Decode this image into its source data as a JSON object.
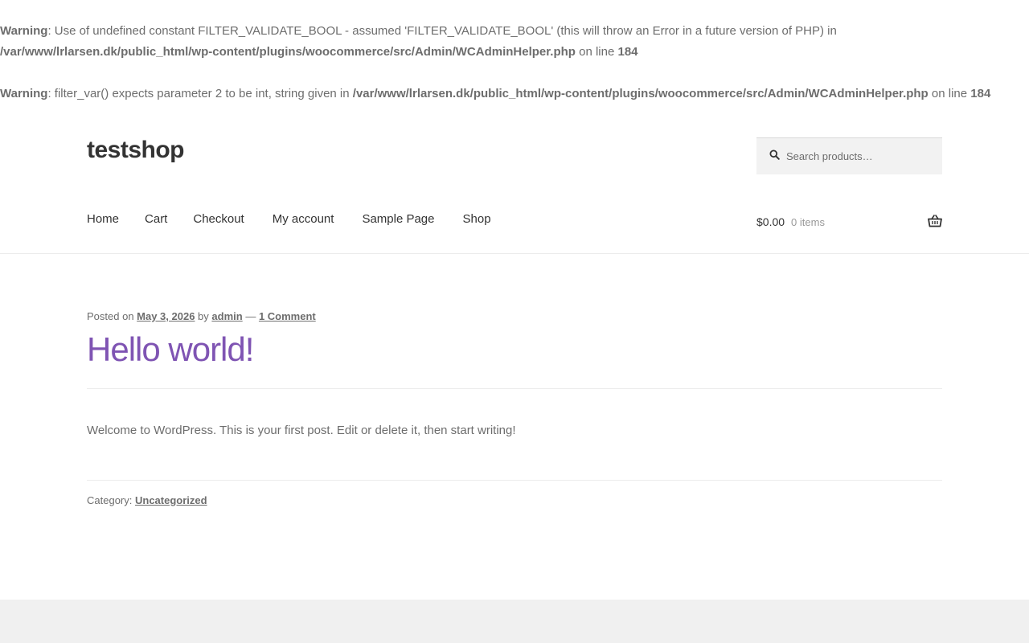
{
  "warnings": [
    {
      "label": "Warning",
      "message": ": Use of undefined constant FILTER_VALIDATE_BOOL - assumed 'FILTER_VALIDATE_BOOL' (this will throw an Error in a future version of PHP) in ",
      "path": "/var/www/lrlarsen.dk/public_html/wp-content/plugins/woocommerce/src/Admin/WCAdminHelper.php",
      "on_line": " on line ",
      "line": "184"
    },
    {
      "label": "Warning",
      "message": ": filter_var() expects parameter 2 to be int, string given in ",
      "path": "/var/www/lrlarsen.dk/public_html/wp-content/plugins/woocommerce/src/Admin/WCAdminHelper.php",
      "on_line": " on line ",
      "line": "184"
    }
  ],
  "site": {
    "title": "testshop"
  },
  "search": {
    "placeholder": "Search products…"
  },
  "nav": {
    "items": [
      "Home",
      "Cart",
      "Checkout",
      "My account",
      "Sample Page",
      "Shop"
    ]
  },
  "cart": {
    "amount": "$0.00",
    "count": "0 items"
  },
  "post": {
    "posted_on_label": "Posted on ",
    "date": "May 3, 2026",
    "by_label": " by ",
    "author": "admin",
    "separator": " — ",
    "comments": "1 Comment",
    "title": "Hello world!",
    "content": "Welcome to WordPress. This is your first post. Edit or delete it, then start writing!",
    "category_label": "Category: ",
    "category": "Uncategorized"
  },
  "colors": {
    "accent": "#7f54b3",
    "text": "#6d6d6d",
    "heading": "#333333",
    "footer_bg": "#f0f0f0"
  },
  "icons": {
    "search": "search-icon",
    "cart": "basket-icon"
  }
}
